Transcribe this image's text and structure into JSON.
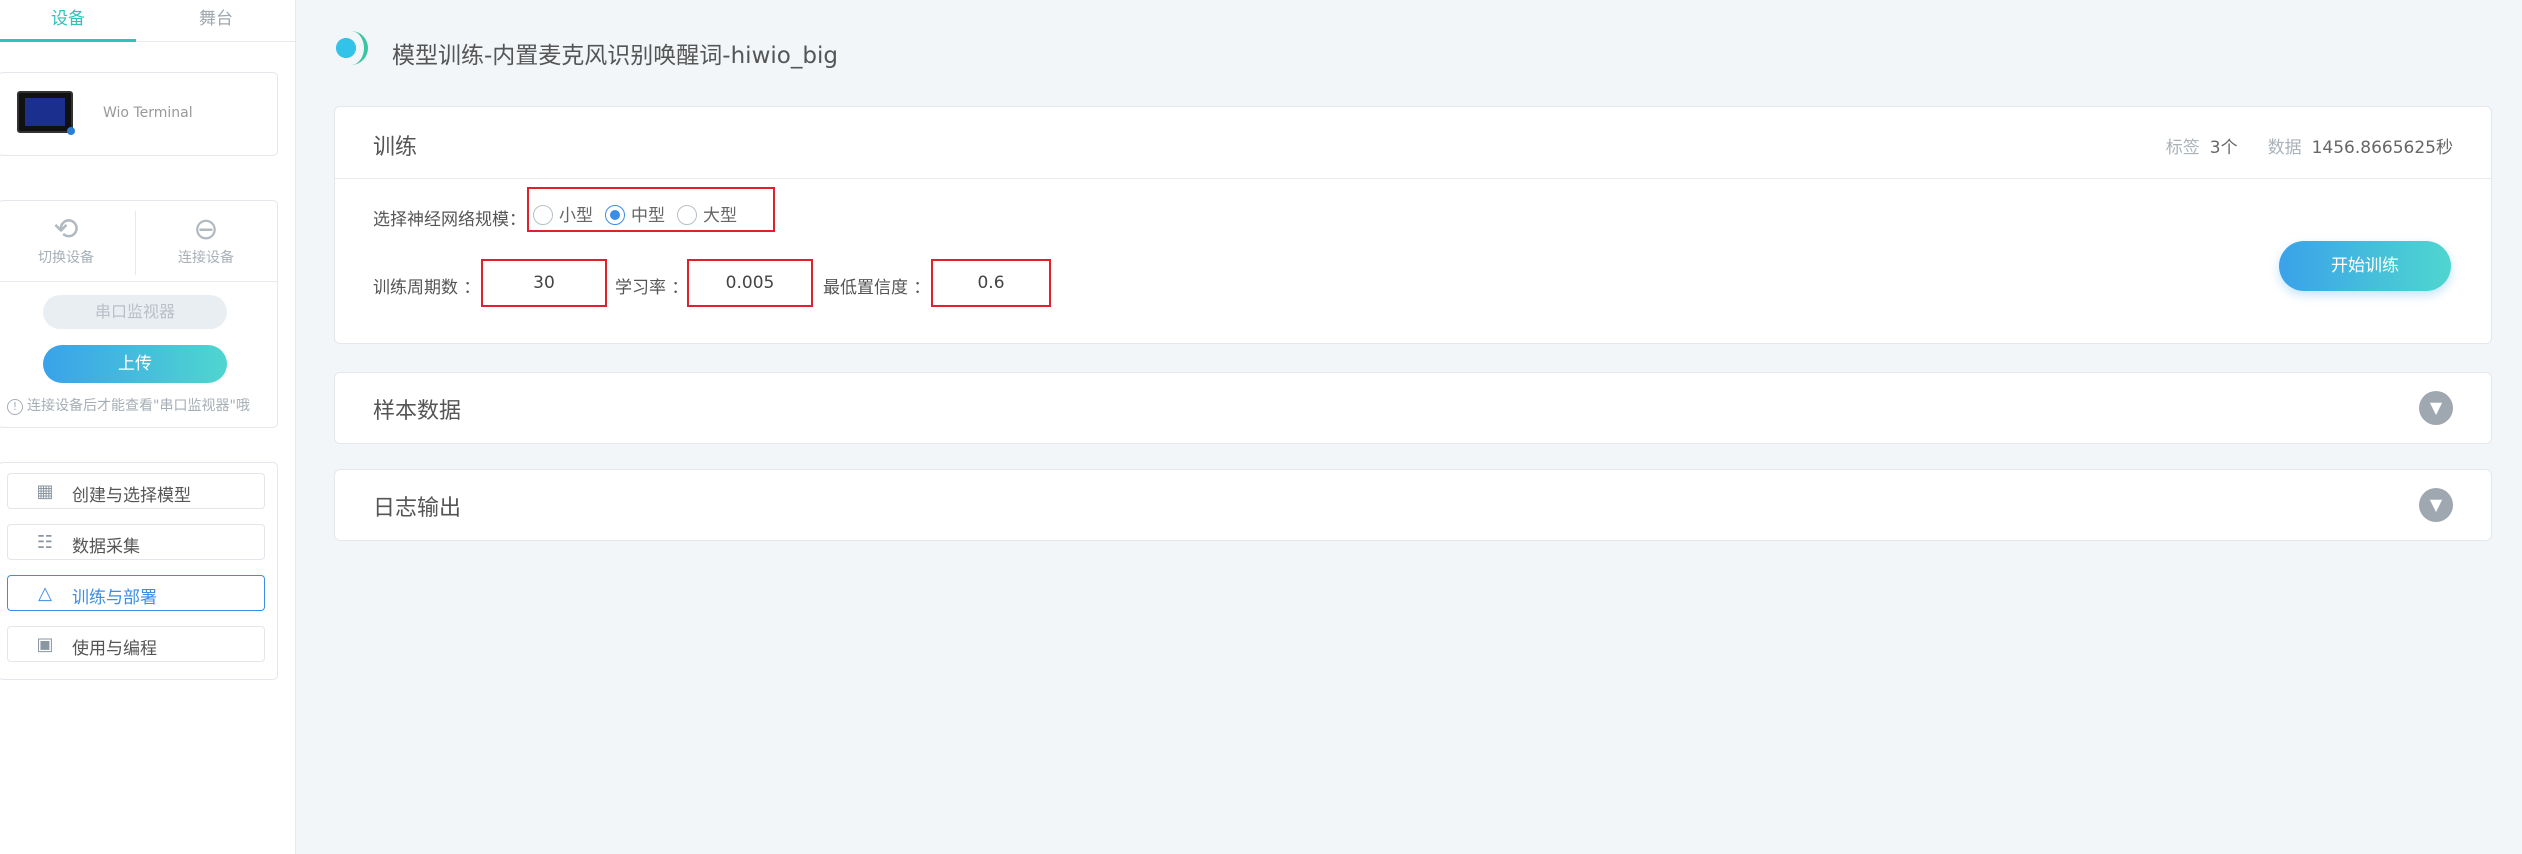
{
  "sidebar": {
    "tabs": [
      "设备",
      "舞台"
    ],
    "device_name": "Wio Terminal",
    "controls": {
      "switch_label": "切换设备",
      "connect_label": "连接设备",
      "serial_label": "串口监视器",
      "upload_label": "上传",
      "hint": "连接设备后才能查看\"串口监视器\"哦"
    },
    "nav": [
      {
        "label": "创建与选择模型",
        "icon": "grid-plus-icon"
      },
      {
        "label": "数据采集",
        "icon": "data-list-icon"
      },
      {
        "label": "训练与部署",
        "icon": "network-nodes-icon"
      },
      {
        "label": "使用与编程",
        "icon": "code-window-icon"
      }
    ]
  },
  "main": {
    "page_title": "模型训练-内置麦克风识别唤醒词-hiwio_big",
    "train_panel": {
      "title": "训练",
      "tags_label": "标签",
      "tags_value": "3个",
      "data_label": "数据",
      "data_value": "1456.8665625秒",
      "network_label": "选择神经网络规模：",
      "sizes": [
        "小型",
        "中型",
        "大型"
      ],
      "selected_size": "中型",
      "epochs_label": "训练周期数 ：",
      "epochs_value": "30",
      "lr_label": "学习率 ：",
      "lr_value": "0.005",
      "confidence_label": "最低置信度 ：",
      "confidence_value": "0.6",
      "start_button": "开始训练"
    },
    "sample_panel_title": "样本数据",
    "log_panel_title": "日志输出"
  }
}
